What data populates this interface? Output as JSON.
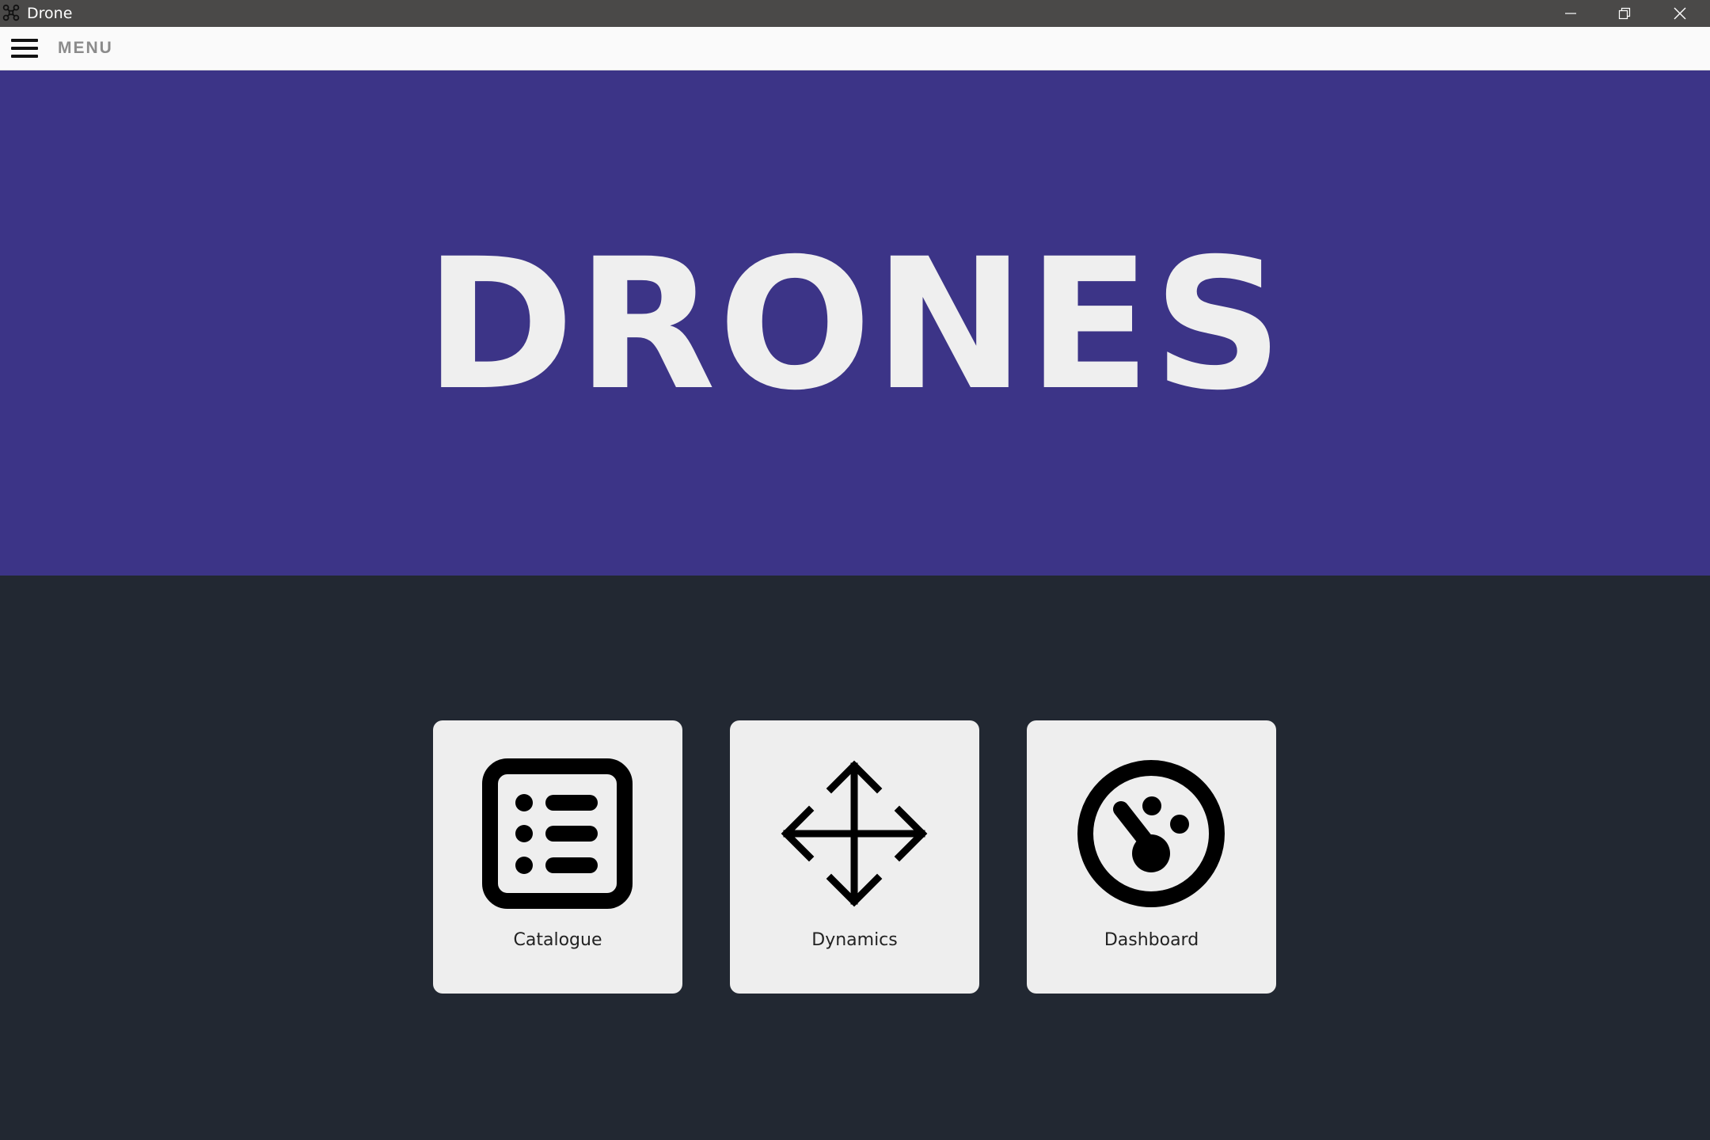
{
  "window": {
    "title": "Drone",
    "app_icon": "drone-icon",
    "controls": [
      "minimize-icon",
      "restore-icon",
      "close-icon"
    ]
  },
  "menubar": {
    "menu_icon": "hamburger-icon",
    "menu_label": "MENU"
  },
  "hero": {
    "title": "DRONES",
    "background": "#3c3487"
  },
  "tiles": [
    {
      "label": "Catalogue",
      "icon": "list-icon"
    },
    {
      "label": "Dynamics",
      "icon": "move-arrows-icon"
    },
    {
      "label": "Dashboard",
      "icon": "gauge-icon"
    }
  ],
  "colors": {
    "titlebar": "#4a4948",
    "hero": "#3c3487",
    "content_bg": "#222832",
    "tile_bg": "#eeeeee"
  }
}
